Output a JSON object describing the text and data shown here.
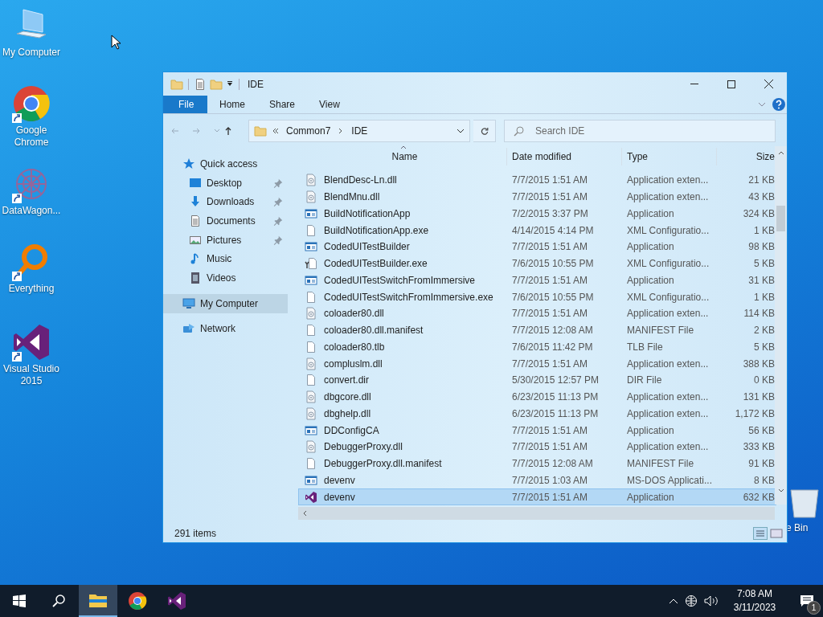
{
  "desktop_icons": [
    {
      "label": "My Computer",
      "kind": "computer",
      "shortcut": false
    },
    {
      "label": "Google Chrome",
      "kind": "chrome",
      "shortcut": true
    },
    {
      "label": "DataWagon...",
      "kind": "datawagon",
      "shortcut": true
    },
    {
      "label": "Everything",
      "kind": "everything",
      "shortcut": true
    },
    {
      "label": "Visual Studio 2015",
      "kind": "vs",
      "shortcut": true
    },
    {
      "label": "e Bin",
      "kind": "bin",
      "shortcut": false
    }
  ],
  "window": {
    "title": "IDE",
    "ribbon_tabs": [
      {
        "label": "File",
        "kind": "file"
      },
      {
        "label": "Home",
        "kind": "tab"
      },
      {
        "label": "Share",
        "kind": "tab"
      },
      {
        "label": "View",
        "kind": "tab"
      }
    ],
    "address": [
      "Common7",
      "IDE"
    ],
    "search": {
      "placeholder": "Search IDE"
    },
    "sidebar": {
      "items": [
        {
          "label": "Quick access",
          "kind": "star",
          "selected": false,
          "children": [
            {
              "label": "Desktop",
              "kind": "desktop",
              "selected": false,
              "pinned": true
            },
            {
              "label": "Downloads",
              "kind": "downloads",
              "selected": false,
              "pinned": true
            },
            {
              "label": "Documents",
              "kind": "documents",
              "selected": false,
              "pinned": true
            },
            {
              "label": "Pictures",
              "kind": "pictures",
              "selected": false,
              "pinned": true
            },
            {
              "label": "Music",
              "kind": "music",
              "selected": false,
              "pinned": false
            },
            {
              "label": "Videos",
              "kind": "videos",
              "selected": false,
              "pinned": false
            }
          ]
        },
        {
          "label": "My Computer",
          "kind": "computer",
          "selected": true
        },
        {
          "label": "Network",
          "kind": "network",
          "selected": false
        }
      ]
    },
    "table": {
      "columns": [
        "Name",
        "Date modified",
        "Type",
        "Size"
      ],
      "rows": [
        {
          "name": "BlendDesc-Ln.dll",
          "kind": "dll",
          "date": "7/7/2015 1:51 AM",
          "type": "Application exten...",
          "size": "21 KB",
          "selected": false
        },
        {
          "name": "BlendMnu.dll",
          "kind": "dll",
          "date": "7/7/2015 1:51 AM",
          "type": "Application exten...",
          "size": "43 KB",
          "selected": false
        },
        {
          "name": "BuildNotificationApp",
          "kind": "app",
          "date": "7/2/2015 3:37 PM",
          "type": "Application",
          "size": "324 KB",
          "selected": false
        },
        {
          "name": "BuildNotificationApp.exe",
          "kind": "file",
          "date": "4/14/2015 4:14 PM",
          "type": "XML Configuratio...",
          "size": "1 KB",
          "selected": false
        },
        {
          "name": "CodedUITestBuilder",
          "kind": "app",
          "date": "7/7/2015 1:51 AM",
          "type": "Application",
          "size": "98 KB",
          "selected": false
        },
        {
          "name": "CodedUITestBuilder.exe",
          "kind": "config",
          "date": "7/6/2015 10:55 PM",
          "type": "XML Configuratio...",
          "size": "5 KB",
          "selected": false
        },
        {
          "name": "CodedUITestSwitchFromImmersive",
          "kind": "app",
          "date": "7/7/2015 1:51 AM",
          "type": "Application",
          "size": "31 KB",
          "selected": false
        },
        {
          "name": "CodedUITestSwitchFromImmersive.exe",
          "kind": "file",
          "date": "7/6/2015 10:55 PM",
          "type": "XML Configuratio...",
          "size": "1 KB",
          "selected": false
        },
        {
          "name": "coloader80.dll",
          "kind": "dll",
          "date": "7/7/2015 1:51 AM",
          "type": "Application exten...",
          "size": "114 KB",
          "selected": false
        },
        {
          "name": "coloader80.dll.manifest",
          "kind": "file",
          "date": "7/7/2015 12:08 AM",
          "type": "MANIFEST File",
          "size": "2 KB",
          "selected": false
        },
        {
          "name": "coloader80.tlb",
          "kind": "file",
          "date": "7/6/2015 11:42 PM",
          "type": "TLB File",
          "size": "5 KB",
          "selected": false
        },
        {
          "name": "compluslm.dll",
          "kind": "dll",
          "date": "7/7/2015 1:51 AM",
          "type": "Application exten...",
          "size": "388 KB",
          "selected": false
        },
        {
          "name": "convert.dir",
          "kind": "file",
          "date": "5/30/2015 12:57 PM",
          "type": "DIR File",
          "size": "0 KB",
          "selected": false
        },
        {
          "name": "dbgcore.dll",
          "kind": "dll",
          "date": "6/23/2015 11:13 PM",
          "type": "Application exten...",
          "size": "131 KB",
          "selected": false
        },
        {
          "name": "dbghelp.dll",
          "kind": "dll",
          "date": "6/23/2015 11:13 PM",
          "type": "Application exten...",
          "size": "1,172 KB",
          "selected": false
        },
        {
          "name": "DDConfigCA",
          "kind": "app",
          "date": "7/7/2015 1:51 AM",
          "type": "Application",
          "size": "56 KB",
          "selected": false
        },
        {
          "name": "DebuggerProxy.dll",
          "kind": "dll",
          "date": "7/7/2015 1:51 AM",
          "type": "Application exten...",
          "size": "333 KB",
          "selected": false
        },
        {
          "name": "DebuggerProxy.dll.manifest",
          "kind": "file",
          "date": "7/7/2015 12:08 AM",
          "type": "MANIFEST File",
          "size": "91 KB",
          "selected": false
        },
        {
          "name": "devenv",
          "kind": "app",
          "date": "7/7/2015 1:03 AM",
          "type": "MS-DOS Applicati...",
          "size": "8 KB",
          "selected": false
        },
        {
          "name": "devenv",
          "kind": "vs",
          "date": "7/7/2015 1:51 AM",
          "type": "Application",
          "size": "632 KB",
          "selected": true
        }
      ]
    },
    "status_bar": {
      "count": "291 items"
    }
  },
  "taskbar": {
    "items": [
      {
        "kind": "start",
        "active": false
      },
      {
        "kind": "search",
        "active": false
      },
      {
        "kind": "explorer",
        "active": true
      },
      {
        "kind": "chrome",
        "active": false
      },
      {
        "kind": "vs",
        "active": false
      }
    ],
    "time": "7:08 AM",
    "date": "3/11/2023",
    "notifications": "1"
  }
}
